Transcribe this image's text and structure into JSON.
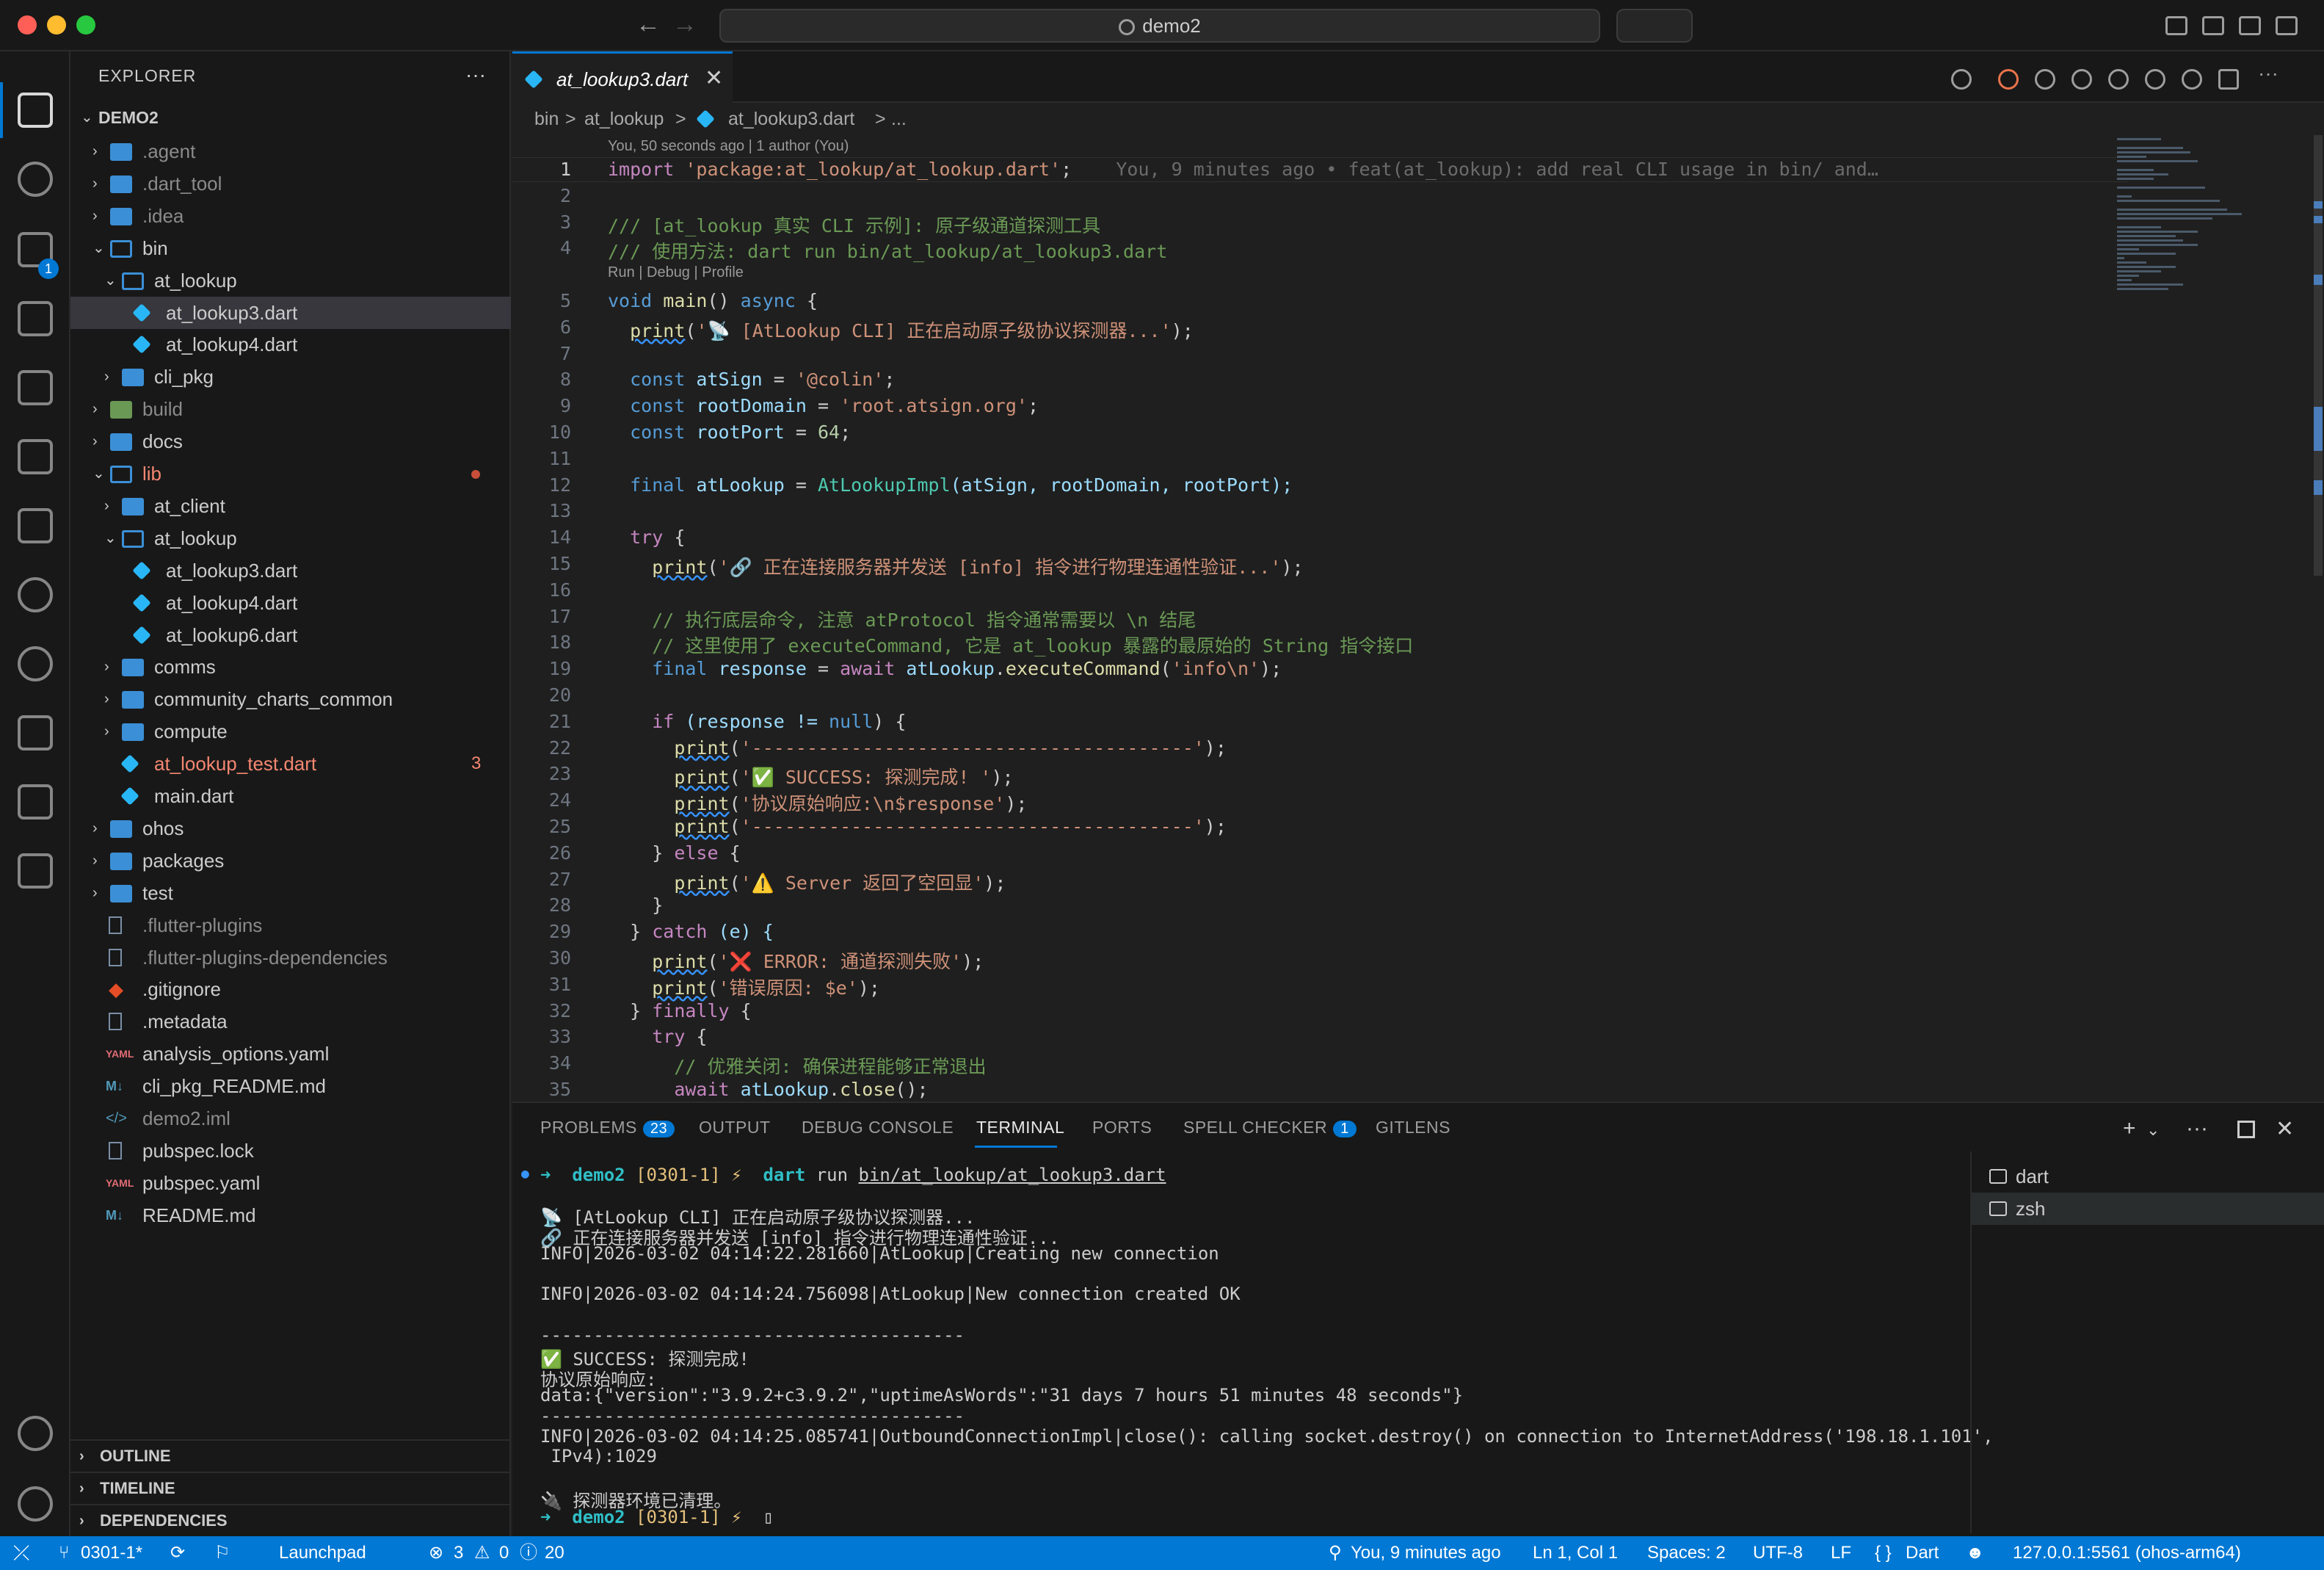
{
  "titlebar": {
    "search_text": "demo2"
  },
  "explorer": {
    "title": "EXPLORER",
    "more": "···",
    "root": "DEMO2",
    "tree": [
      {
        "label": ".agent",
        "indent": 0,
        "kind": "folder",
        "dim": true
      },
      {
        "label": ".dart_tool",
        "indent": 0,
        "kind": "folder",
        "dim": true
      },
      {
        "label": ".idea",
        "indent": 0,
        "kind": "folder",
        "dim": true
      },
      {
        "label": "bin",
        "indent": 0,
        "kind": "folder-open"
      },
      {
        "label": "at_lookup",
        "indent": 1,
        "kind": "folder-open"
      },
      {
        "label": "at_lookup3.dart",
        "indent": 2,
        "kind": "dart",
        "selected": true
      },
      {
        "label": "at_lookup4.dart",
        "indent": 2,
        "kind": "dart"
      },
      {
        "label": "cli_pkg",
        "indent": 1,
        "kind": "folder"
      },
      {
        "label": "build",
        "indent": 0,
        "kind": "folder-build",
        "dim": true
      },
      {
        "label": "docs",
        "indent": 0,
        "kind": "folder"
      },
      {
        "label": "lib",
        "indent": 0,
        "kind": "folder-open",
        "error": true,
        "dot": true
      },
      {
        "label": "at_client",
        "indent": 1,
        "kind": "folder"
      },
      {
        "label": "at_lookup",
        "indent": 1,
        "kind": "folder-open"
      },
      {
        "label": "at_lookup3.dart",
        "indent": 2,
        "kind": "dart"
      },
      {
        "label": "at_lookup4.dart",
        "indent": 2,
        "kind": "dart"
      },
      {
        "label": "at_lookup6.dart",
        "indent": 2,
        "kind": "dart"
      },
      {
        "label": "comms",
        "indent": 1,
        "kind": "folder"
      },
      {
        "label": "community_charts_common",
        "indent": 1,
        "kind": "folder"
      },
      {
        "label": "compute",
        "indent": 1,
        "kind": "folder"
      },
      {
        "label": "at_lookup_test.dart",
        "indent": 1,
        "kind": "dart",
        "error": true,
        "count": "3"
      },
      {
        "label": "main.dart",
        "indent": 1,
        "kind": "dart"
      },
      {
        "label": "ohos",
        "indent": 0,
        "kind": "folder"
      },
      {
        "label": "packages",
        "indent": 0,
        "kind": "folder"
      },
      {
        "label": "test",
        "indent": 0,
        "kind": "folder-test"
      },
      {
        "label": ".flutter-plugins",
        "indent": 0,
        "kind": "file",
        "dim": true
      },
      {
        "label": ".flutter-plugins-dependencies",
        "indent": 0,
        "kind": "file",
        "dim": true
      },
      {
        "label": ".gitignore",
        "indent": 0,
        "kind": "git"
      },
      {
        "label": ".metadata",
        "indent": 0,
        "kind": "file"
      },
      {
        "label": "analysis_options.yaml",
        "indent": 0,
        "kind": "yaml"
      },
      {
        "label": "cli_pkg_README.md",
        "indent": 0,
        "kind": "md"
      },
      {
        "label": "demo2.iml",
        "indent": 0,
        "kind": "xml",
        "dim": true
      },
      {
        "label": "pubspec.lock",
        "indent": 0,
        "kind": "file"
      },
      {
        "label": "pubspec.yaml",
        "indent": 0,
        "kind": "yaml"
      },
      {
        "label": "README.md",
        "indent": 0,
        "kind": "md"
      }
    ],
    "sections": [
      "OUTLINE",
      "TIMELINE",
      "DEPENDENCIES"
    ]
  },
  "editor": {
    "tab_label": "at_lookup3.dart",
    "breadcrumb": [
      "bin",
      ">",
      "at_lookup",
      ">",
      "at_lookup3.dart",
      ">",
      "..."
    ],
    "lens_blame": "You, 50 seconds ago | 1 author (You)",
    "lens_run": "Run | Debug | Profile",
    "ghost_blame": "You, 9 minutes ago • feat(at_lookup): add real CLI usage in bin/ and…",
    "lines": [
      [
        {
          "t": "import ",
          "c": "kw2"
        },
        {
          "t": "'package:at_lookup/at_lookup.dart'",
          "c": "str"
        },
        {
          "t": ";",
          "c": ""
        }
      ],
      [],
      [
        {
          "t": "/// [at_lookup 真实 CLI 示例]: 原子级通道探测工具",
          "c": "cm"
        }
      ],
      [
        {
          "t": "/// 使用方法: dart run bin/at_lookup/at_lookup3.dart",
          "c": "cm"
        }
      ],
      [
        {
          "t": "void ",
          "c": "kw"
        },
        {
          "t": "main",
          "c": "fn"
        },
        {
          "t": "() ",
          "c": ""
        },
        {
          "t": "async",
          "c": "kw"
        },
        {
          "t": " {",
          "c": ""
        }
      ],
      [
        {
          "t": "  ",
          "c": ""
        },
        {
          "t": "print",
          "c": "fn sq"
        },
        {
          "t": "(",
          "c": ""
        },
        {
          "t": "'📡 [AtLookup CLI] 正在启动原子级协议探测器...'",
          "c": "str"
        },
        {
          "t": ");",
          "c": ""
        }
      ],
      [],
      [
        {
          "t": "  ",
          "c": ""
        },
        {
          "t": "const ",
          "c": "kw"
        },
        {
          "t": "atSign",
          "c": "vr"
        },
        {
          "t": " = ",
          "c": ""
        },
        {
          "t": "'@colin'",
          "c": "str"
        },
        {
          "t": ";",
          "c": ""
        }
      ],
      [
        {
          "t": "  ",
          "c": ""
        },
        {
          "t": "const ",
          "c": "kw"
        },
        {
          "t": "rootDomain",
          "c": "vr"
        },
        {
          "t": " = ",
          "c": ""
        },
        {
          "t": "'root.atsign.org'",
          "c": "str"
        },
        {
          "t": ";",
          "c": ""
        }
      ],
      [
        {
          "t": "  ",
          "c": ""
        },
        {
          "t": "const ",
          "c": "kw"
        },
        {
          "t": "rootPort",
          "c": "vr"
        },
        {
          "t": " = ",
          "c": ""
        },
        {
          "t": "64",
          "c": "nu"
        },
        {
          "t": ";",
          "c": ""
        }
      ],
      [],
      [
        {
          "t": "  ",
          "c": ""
        },
        {
          "t": "final ",
          "c": "kw"
        },
        {
          "t": "atLookup",
          "c": "vr"
        },
        {
          "t": " = ",
          "c": ""
        },
        {
          "t": "AtLookupImpl",
          "c": "ty"
        },
        {
          "t": "(atSign, rootDomain, rootPort);",
          "c": "vr"
        }
      ],
      [],
      [
        {
          "t": "  ",
          "c": ""
        },
        {
          "t": "try",
          "c": "kw2"
        },
        {
          "t": " {",
          "c": ""
        }
      ],
      [
        {
          "t": "    ",
          "c": ""
        },
        {
          "t": "print",
          "c": "fn sq"
        },
        {
          "t": "(",
          "c": ""
        },
        {
          "t": "'🔗 正在连接服务器并发送 [info] 指令进行物理连通性验证...'",
          "c": "str"
        },
        {
          "t": ");",
          "c": ""
        }
      ],
      [],
      [
        {
          "t": "    // 执行底层命令, 注意 atProtocol 指令通常需要以 \\n 结尾",
          "c": "cm"
        }
      ],
      [
        {
          "t": "    // 这里使用了 executeCommand, 它是 at_lookup 暴露的最原始的 String 指令接口",
          "c": "cm"
        }
      ],
      [
        {
          "t": "    ",
          "c": ""
        },
        {
          "t": "final ",
          "c": "kw"
        },
        {
          "t": "response",
          "c": "vr"
        },
        {
          "t": " = ",
          "c": ""
        },
        {
          "t": "await ",
          "c": "kw2"
        },
        {
          "t": "atLookup",
          "c": "vr"
        },
        {
          "t": ".",
          "c": ""
        },
        {
          "t": "executeCommand",
          "c": "fn"
        },
        {
          "t": "(",
          "c": ""
        },
        {
          "t": "'info\\n'",
          "c": "str"
        },
        {
          "t": ");",
          "c": ""
        }
      ],
      [],
      [
        {
          "t": "    ",
          "c": ""
        },
        {
          "t": "if",
          "c": "kw2"
        },
        {
          "t": " (response != ",
          "c": "vr"
        },
        {
          "t": "null",
          "c": "kw"
        },
        {
          "t": ") {",
          "c": ""
        }
      ],
      [
        {
          "t": "      ",
          "c": ""
        },
        {
          "t": "print",
          "c": "fn sq"
        },
        {
          "t": "(",
          "c": ""
        },
        {
          "t": "'----------------------------------------'",
          "c": "str"
        },
        {
          "t": ");",
          "c": ""
        }
      ],
      [
        {
          "t": "      ",
          "c": ""
        },
        {
          "t": "print",
          "c": "fn sq"
        },
        {
          "t": "(",
          "c": ""
        },
        {
          "t": "'✅ SUCCESS: 探测完成! '",
          "c": "str"
        },
        {
          "t": ");",
          "c": ""
        }
      ],
      [
        {
          "t": "      ",
          "c": ""
        },
        {
          "t": "print",
          "c": "fn sq"
        },
        {
          "t": "(",
          "c": ""
        },
        {
          "t": "'协议原始响应:\\n$response'",
          "c": "str"
        },
        {
          "t": ");",
          "c": ""
        }
      ],
      [
        {
          "t": "      ",
          "c": ""
        },
        {
          "t": "print",
          "c": "fn sq"
        },
        {
          "t": "(",
          "c": ""
        },
        {
          "t": "'----------------------------------------'",
          "c": "str"
        },
        {
          "t": ");",
          "c": ""
        }
      ],
      [
        {
          "t": "    } ",
          "c": ""
        },
        {
          "t": "else",
          "c": "kw2"
        },
        {
          "t": " {",
          "c": ""
        }
      ],
      [
        {
          "t": "      ",
          "c": ""
        },
        {
          "t": "print",
          "c": "fn sq"
        },
        {
          "t": "(",
          "c": ""
        },
        {
          "t": "'⚠️ Server 返回了空回显'",
          "c": "str"
        },
        {
          "t": ");",
          "c": ""
        }
      ],
      [
        {
          "t": "    }",
          "c": ""
        }
      ],
      [
        {
          "t": "  } ",
          "c": ""
        },
        {
          "t": "catch",
          "c": "kw2"
        },
        {
          "t": " (e) {",
          "c": "vr"
        }
      ],
      [
        {
          "t": "    ",
          "c": ""
        },
        {
          "t": "print",
          "c": "fn sq"
        },
        {
          "t": "(",
          "c": ""
        },
        {
          "t": "'❌ ERROR: 通道探测失败'",
          "c": "str"
        },
        {
          "t": ");",
          "c": ""
        }
      ],
      [
        {
          "t": "    ",
          "c": ""
        },
        {
          "t": "print",
          "c": "fn sq"
        },
        {
          "t": "(",
          "c": ""
        },
        {
          "t": "'错误原因: $e'",
          "c": "str"
        },
        {
          "t": ");",
          "c": ""
        }
      ],
      [
        {
          "t": "  } ",
          "c": ""
        },
        {
          "t": "finally",
          "c": "kw2"
        },
        {
          "t": " {",
          "c": ""
        }
      ],
      [
        {
          "t": "    ",
          "c": ""
        },
        {
          "t": "try",
          "c": "kw2"
        },
        {
          "t": " {",
          "c": ""
        }
      ],
      [
        {
          "t": "      // 优雅关闭: 确保进程能够正常退出",
          "c": "cm"
        }
      ],
      [
        {
          "t": "      ",
          "c": ""
        },
        {
          "t": "await ",
          "c": "kw2"
        },
        {
          "t": "atLookup",
          "c": "vr"
        },
        {
          "t": ".",
          "c": ""
        },
        {
          "t": "close",
          "c": "fn"
        },
        {
          "t": "();",
          "c": ""
        }
      ]
    ]
  },
  "panel": {
    "tabs": [
      {
        "label": "PROBLEMS",
        "badge": "23"
      },
      {
        "label": "OUTPUT"
      },
      {
        "label": "DEBUG CONSOLE"
      },
      {
        "label": "TERMINAL",
        "active": true
      },
      {
        "label": "PORTS"
      },
      {
        "label": "SPELL CHECKER",
        "badge": "1"
      },
      {
        "label": "GITLENS"
      }
    ],
    "prompt_dir": "demo2",
    "prompt_branch": "[0301-1]",
    "prompt_mark": "⚡",
    "command_name": "dart",
    "command_args": " run ",
    "command_path": "bin/at_lookup/at_lookup3.dart",
    "output": [
      "📡 [AtLookup CLI] 正在启动原子级协议探测器...",
      "🔗 正在连接服务器并发送 [info] 指令进行物理连通性验证...",
      "INFO|2026-03-02 04:14:22.281660|AtLookup|Creating new connection",
      "",
      "INFO|2026-03-02 04:14:24.756098|AtLookup|New connection created OK",
      "",
      "----------------------------------------",
      "✅ SUCCESS: 探测完成!",
      "协议原始响应:",
      "data:{\"version\":\"3.9.2+c3.9.2\",\"uptimeAsWords\":\"31 days 7 hours 51 minutes 48 seconds\"}",
      "----------------------------------------",
      "INFO|2026-03-02 04:14:25.085741|OutboundConnectionImpl|close(): calling socket.destroy() on connection to InternetAddress('198.18.1.101',",
      " IPv4):1029",
      "",
      "🔌 探测器环境已清理。"
    ],
    "terminals": [
      "dart",
      "zsh"
    ],
    "actions": {
      "add": "+",
      "more": "···",
      "close": "✕"
    }
  },
  "statusbar": {
    "branch": "0301-1*",
    "remote": "Launchpad",
    "errors": "3",
    "warnings": "0",
    "infos": "20",
    "blame": "You, 9 minutes ago",
    "position": "Ln 1, Col 1",
    "spaces": "Spaces: 2",
    "encoding": "UTF-8",
    "eol": "LF",
    "language": "Dart",
    "device": "127.0.0.1:5561 (ohos-arm64)"
  },
  "colors": {
    "accent": "#0078d4",
    "error": "#f48771"
  }
}
